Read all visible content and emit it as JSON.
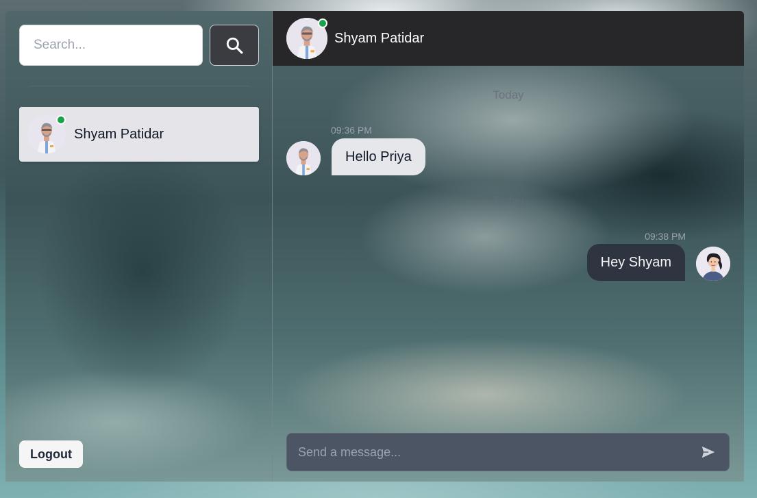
{
  "sidebar": {
    "search": {
      "placeholder": "Search...",
      "value": ""
    },
    "search_button_icon": "search-icon",
    "conversations": [
      {
        "name": "Shyam Patidar",
        "online": true
      }
    ],
    "logout_label": "Logout"
  },
  "chat": {
    "header": {
      "name": "Shyam Patidar",
      "online": true
    },
    "messages": [
      {
        "day": "Today",
        "time": "09:36 PM",
        "text": "Hello Priya",
        "direction": "incoming"
      },
      {
        "day": "Today",
        "time": "09:38 PM",
        "text": "Hey Shyam",
        "direction": "outgoing"
      }
    ],
    "composer": {
      "placeholder": "Send a message...",
      "value": ""
    },
    "send_icon": "send-icon"
  },
  "colors": {
    "online": "#16a34a",
    "header_bg": "#27272a",
    "incoming_bubble": "#e5e7eb",
    "outgoing_bubble": "#2f3441",
    "composer_bg": "#4b5563"
  }
}
